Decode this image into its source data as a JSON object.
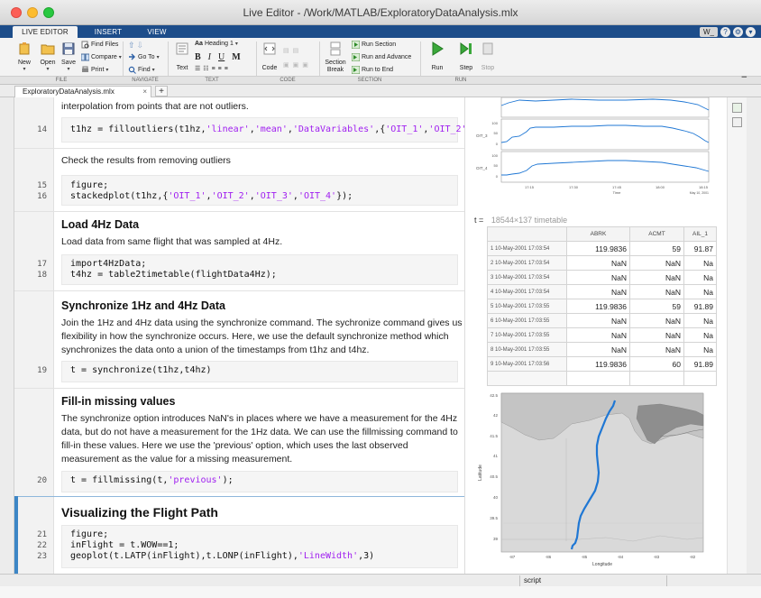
{
  "window": {
    "title": "Live Editor - /Work/MATLAB/ExploratoryDataAnalysis.mlx"
  },
  "ribbon_tabs": [
    {
      "label": "LIVE EDITOR"
    },
    {
      "label": "INSERT"
    },
    {
      "label": "VIEW"
    }
  ],
  "user_badge": "W_",
  "ribbon": {
    "file": {
      "new": "New",
      "open": "Open",
      "save": "Save",
      "find_files": "Find Files",
      "compare": "Compare",
      "print": "Print",
      "group": "FILE"
    },
    "navigate": {
      "go_to": "Go To",
      "find": "Find",
      "group": "NAVIGATE"
    },
    "text": {
      "text": "Text",
      "style": "Heading 1",
      "bold": "B",
      "italic": "I",
      "underline": "U",
      "mono": "M",
      "group": "TEXT"
    },
    "code": {
      "code": "Code",
      "group": "CODE"
    },
    "section": {
      "section_break": "Section\nBreak",
      "run_section": "Run Section",
      "run_and_advance": "Run and Advance",
      "run_to_end": "Run to End",
      "group": "SECTION"
    },
    "run": {
      "run": "Run",
      "step": "Step",
      "stop": "Stop",
      "group": "RUN"
    }
  },
  "doc_tab": {
    "label": "ExploratoryDataAnalysis.mlx",
    "close": "×",
    "add": "+"
  },
  "editor": {
    "text_top": "interpolation from points that are not outliers.",
    "line14": {
      "num": "14",
      "code_pre": "t1hz = filloutliers(t1hz,",
      "s1": "'linear'",
      "c1": ",",
      "s2": "'mean'",
      "c2": ",",
      "s3": "'DataVariables'",
      "c3": ",{",
      "s4": "'OIT_1'",
      "c4": ",",
      "s5": "'OIT_2'",
      "c5": ","
    },
    "check_text": "Check the results from removing outliers",
    "line15": {
      "num": "15",
      "code": "figure;"
    },
    "line16": {
      "num": "16",
      "code_pre": "stackedplot(t1hz,{",
      "s1": "'OIT_1'",
      "s2": "'OIT_2'",
      "s3": "'OIT_3'",
      "s4": "'OIT_4'",
      "code_post": "});"
    },
    "h_load": "Load 4Hz Data",
    "load_text": "Load data from same flight that was sampled at 4Hz.",
    "line17": {
      "num": "17",
      "code": "import4HzData;"
    },
    "line18": {
      "num": "18",
      "code": "t4hz = table2timetable(flightData4Hz);"
    },
    "h_sync": "Synchronize 1Hz and 4Hz Data",
    "sync_text": [
      "Join the 1Hz and 4Hz data using the synchronize command.  The sychronize command gives us",
      "flexibility in how the synchronize occurs.  Here, we use the default synchronize method which",
      "synchronizes the data onto a union of the timestamps from t1hz and t4hz."
    ],
    "line19": {
      "num": "19",
      "code": "t = synchronize(t1hz,t4hz)"
    },
    "h_fill": "Fill-in missing values",
    "fill_text": [
      "The synchronize option introduces NaN's in places where we have a measurement for the 4Hz",
      "data, but do not have a measurement for the 1Hz data.  We can use the fillmissing command to",
      "fill-in these values.  Here we use the 'previous' option, which uses the last observed",
      "measurement as the value for a missing measurement."
    ],
    "line20": {
      "num": "20",
      "code_pre": "t = fillmissing(t,",
      "s1": "'previous'",
      "code_post": ");"
    },
    "h_vis": "Visualizing the Flight Path",
    "line21": {
      "num": "21",
      "code": "figure;"
    },
    "line22": {
      "num": "22",
      "code": "inFlight = t.WOW==1;"
    },
    "line23": {
      "num": "23",
      "code_pre": "geoplot(t.LATP(inFlight),t.LONP(inFlight),",
      "s1": "'LineWidth'",
      "code_post": ",3)"
    }
  },
  "output": {
    "stacked_plot": {
      "y_labels": [
        "OIT_3",
        "OIT_4"
      ],
      "x_ticks": [
        "17:15",
        "17:30",
        "17:45",
        "18:00",
        "18:15"
      ],
      "x_end_label": "May 10, 2001",
      "x_label": "Time",
      "y_ticks_a": [
        "100",
        "50",
        "0"
      ],
      "y_ticks_b": [
        "100",
        "50",
        "0"
      ]
    },
    "table_title": {
      "var": "t",
      "eq": "=",
      "desc": "18544×137 timetable"
    },
    "table": {
      "headers": [
        "",
        "ABRK",
        "ACMT",
        "AIL_1"
      ],
      "rows": [
        [
          "1 10-May-2001 17:03:54",
          "119.9836",
          "59",
          "91.87"
        ],
        [
          "2 10-May-2001 17:03:54",
          "NaN",
          "NaN",
          "Na"
        ],
        [
          "3 10-May-2001 17:03:54",
          "NaN",
          "NaN",
          "Na"
        ],
        [
          "4 10-May-2001 17:03:54",
          "NaN",
          "NaN",
          "Na"
        ],
        [
          "5 10-May-2001 17:03:55",
          "119.9836",
          "59",
          "91.89"
        ],
        [
          "6 10-May-2001 17:03:55",
          "NaN",
          "NaN",
          "Na"
        ],
        [
          "7 10-May-2001 17:03:55",
          "NaN",
          "NaN",
          "Na"
        ],
        [
          "8 10-May-2001 17:03:55",
          "NaN",
          "NaN",
          "Na"
        ],
        [
          "9 10-May-2001 17:03:56",
          "119.9836",
          "60",
          "91.89"
        ]
      ]
    },
    "geoplot": {
      "y_label": "Latitude",
      "x_label": "Longitude",
      "lat_ticks": [
        "42.5",
        "42",
        "41.5",
        "41",
        "40.5",
        "40",
        "39.5",
        "39"
      ],
      "lon_ticks": [
        "-87",
        "-86",
        "-85",
        "-84",
        "-83",
        "-82"
      ]
    }
  },
  "status": {
    "mode": "script"
  },
  "colors": {
    "ribbon_blue": "#1d4d8a",
    "string_purple": "#a020f0",
    "plot_blue": "#1f77d4",
    "active_section": "#3d86c6"
  }
}
